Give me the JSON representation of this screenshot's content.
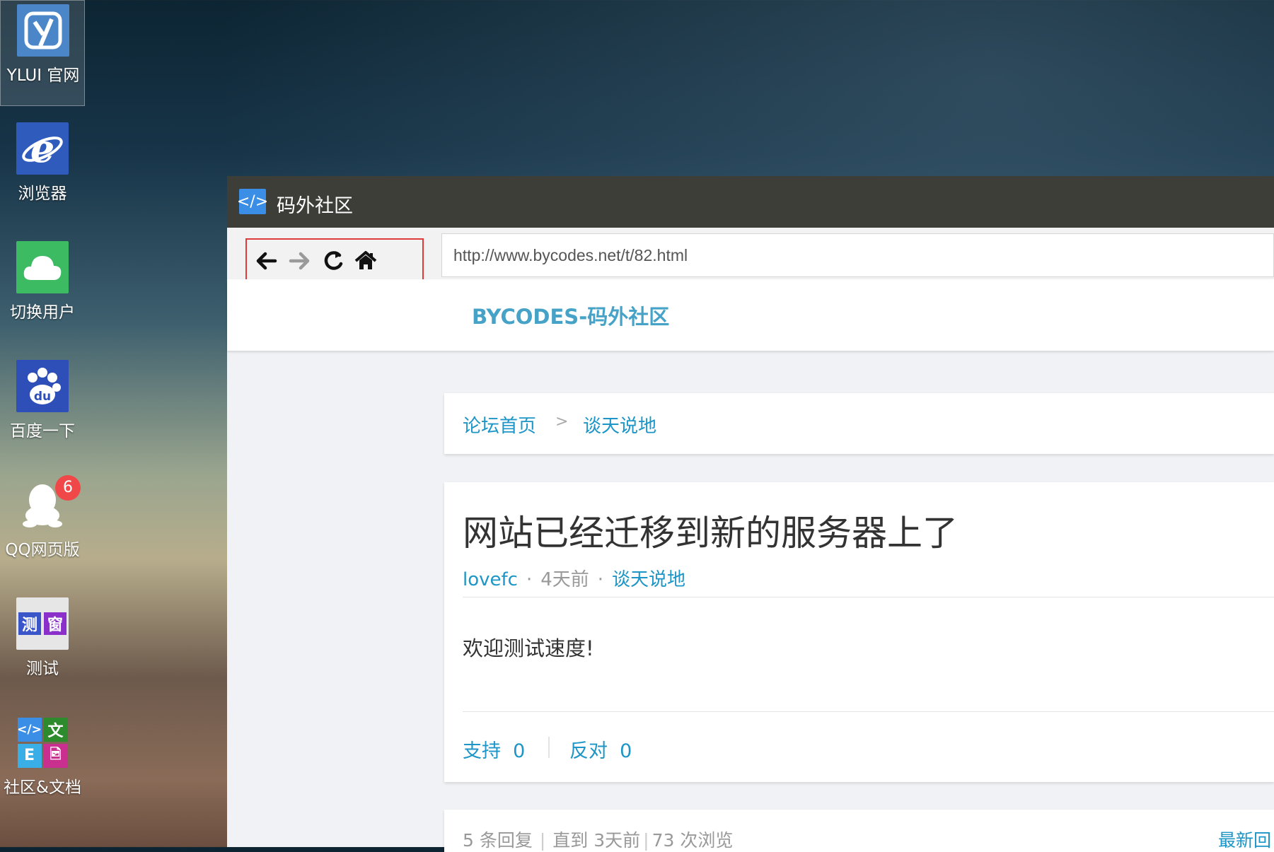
{
  "desktop": {
    "icons": [
      {
        "label": "YLUI 官网",
        "icon": "ylui-logo-icon"
      },
      {
        "label": "浏览器",
        "icon": "ie-browser-icon"
      },
      {
        "label": "切换用户",
        "icon": "cloud-icon"
      },
      {
        "label": "百度一下",
        "icon": "baidu-paw-icon"
      },
      {
        "label": "QQ网页版",
        "icon": "qq-penguin-icon",
        "badge": "6"
      },
      {
        "label": "测试",
        "icon": "test-window-icon",
        "tiles": [
          "测",
          "窗"
        ]
      },
      {
        "label": "社区&文档",
        "icon": "community-docs-icon",
        "tiles": [
          "</>",
          "文",
          "E",
          "🖻"
        ]
      }
    ]
  },
  "window": {
    "title": "码外社区",
    "title_icon": "code-icon",
    "url": "http://www.bycodes.net/t/82.html",
    "nav_buttons": [
      "back-arrow-icon",
      "forward-arrow-icon",
      "refresh-icon",
      "home-icon"
    ]
  },
  "site": {
    "logo": "BYCODES-码外社区",
    "breadcrumb": {
      "home": "论坛首页",
      "separator": ">",
      "section": "谈天说地"
    },
    "topic": {
      "title": "网站已经迁移到新的服务器上了",
      "author": "lovefc",
      "time": "4天前",
      "category": "谈天说地",
      "body": "欢迎测试速度!",
      "support_label": "支持",
      "support_count": "0",
      "oppose_label": "反对",
      "oppose_count": "0"
    },
    "stats": {
      "replies": "5 条回复",
      "until": "直到 3天前",
      "views": "73 次浏览",
      "latest": "最新回"
    }
  },
  "colors": {
    "link": "#1d96c7",
    "logo": "#46a3c7",
    "titlebar": "#3d3e38",
    "highlight_box": "#e03b3b",
    "badge": "#f04848"
  }
}
